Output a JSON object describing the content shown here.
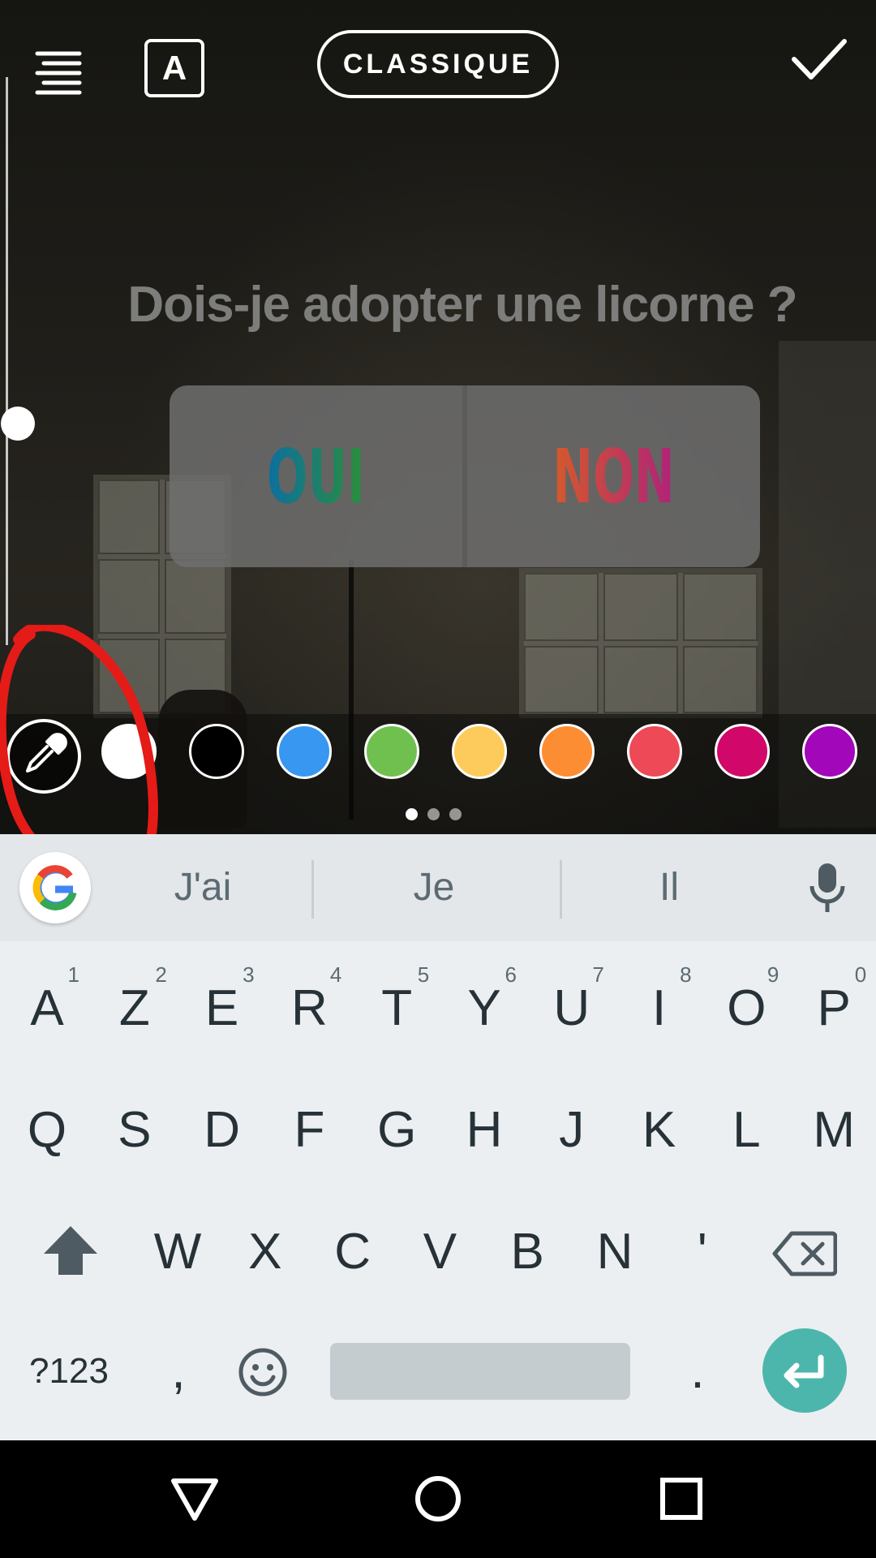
{
  "toolbar": {
    "text_style_label": "A",
    "style_pill_label": "CLASSIQUE"
  },
  "poll": {
    "question": "Dois-je adopter une licorne ?",
    "option_yes": "OUI",
    "option_no": "NON"
  },
  "colors": [
    "#ffffff",
    "#000000",
    "#3897f0",
    "#70c050",
    "#fdcb5c",
    "#fd8d32",
    "#ed4956",
    "#d10869",
    "#a307ba"
  ],
  "suggestions": [
    "J'ai",
    "Je",
    "Il"
  ],
  "keyboard": {
    "row1": [
      {
        "label": "A",
        "hint": "1"
      },
      {
        "label": "Z",
        "hint": "2"
      },
      {
        "label": "E",
        "hint": "3"
      },
      {
        "label": "R",
        "hint": "4"
      },
      {
        "label": "T",
        "hint": "5"
      },
      {
        "label": "Y",
        "hint": "6"
      },
      {
        "label": "U",
        "hint": "7"
      },
      {
        "label": "I",
        "hint": "8"
      },
      {
        "label": "O",
        "hint": "9"
      },
      {
        "label": "P",
        "hint": "0"
      }
    ],
    "row2": [
      "Q",
      "S",
      "D",
      "F",
      "G",
      "H",
      "J",
      "K",
      "L",
      "M"
    ],
    "row3": [
      "W",
      "X",
      "C",
      "V",
      "B",
      "N",
      "'"
    ],
    "symbols_label": "?123",
    "comma_label": ",",
    "period_label": "."
  }
}
